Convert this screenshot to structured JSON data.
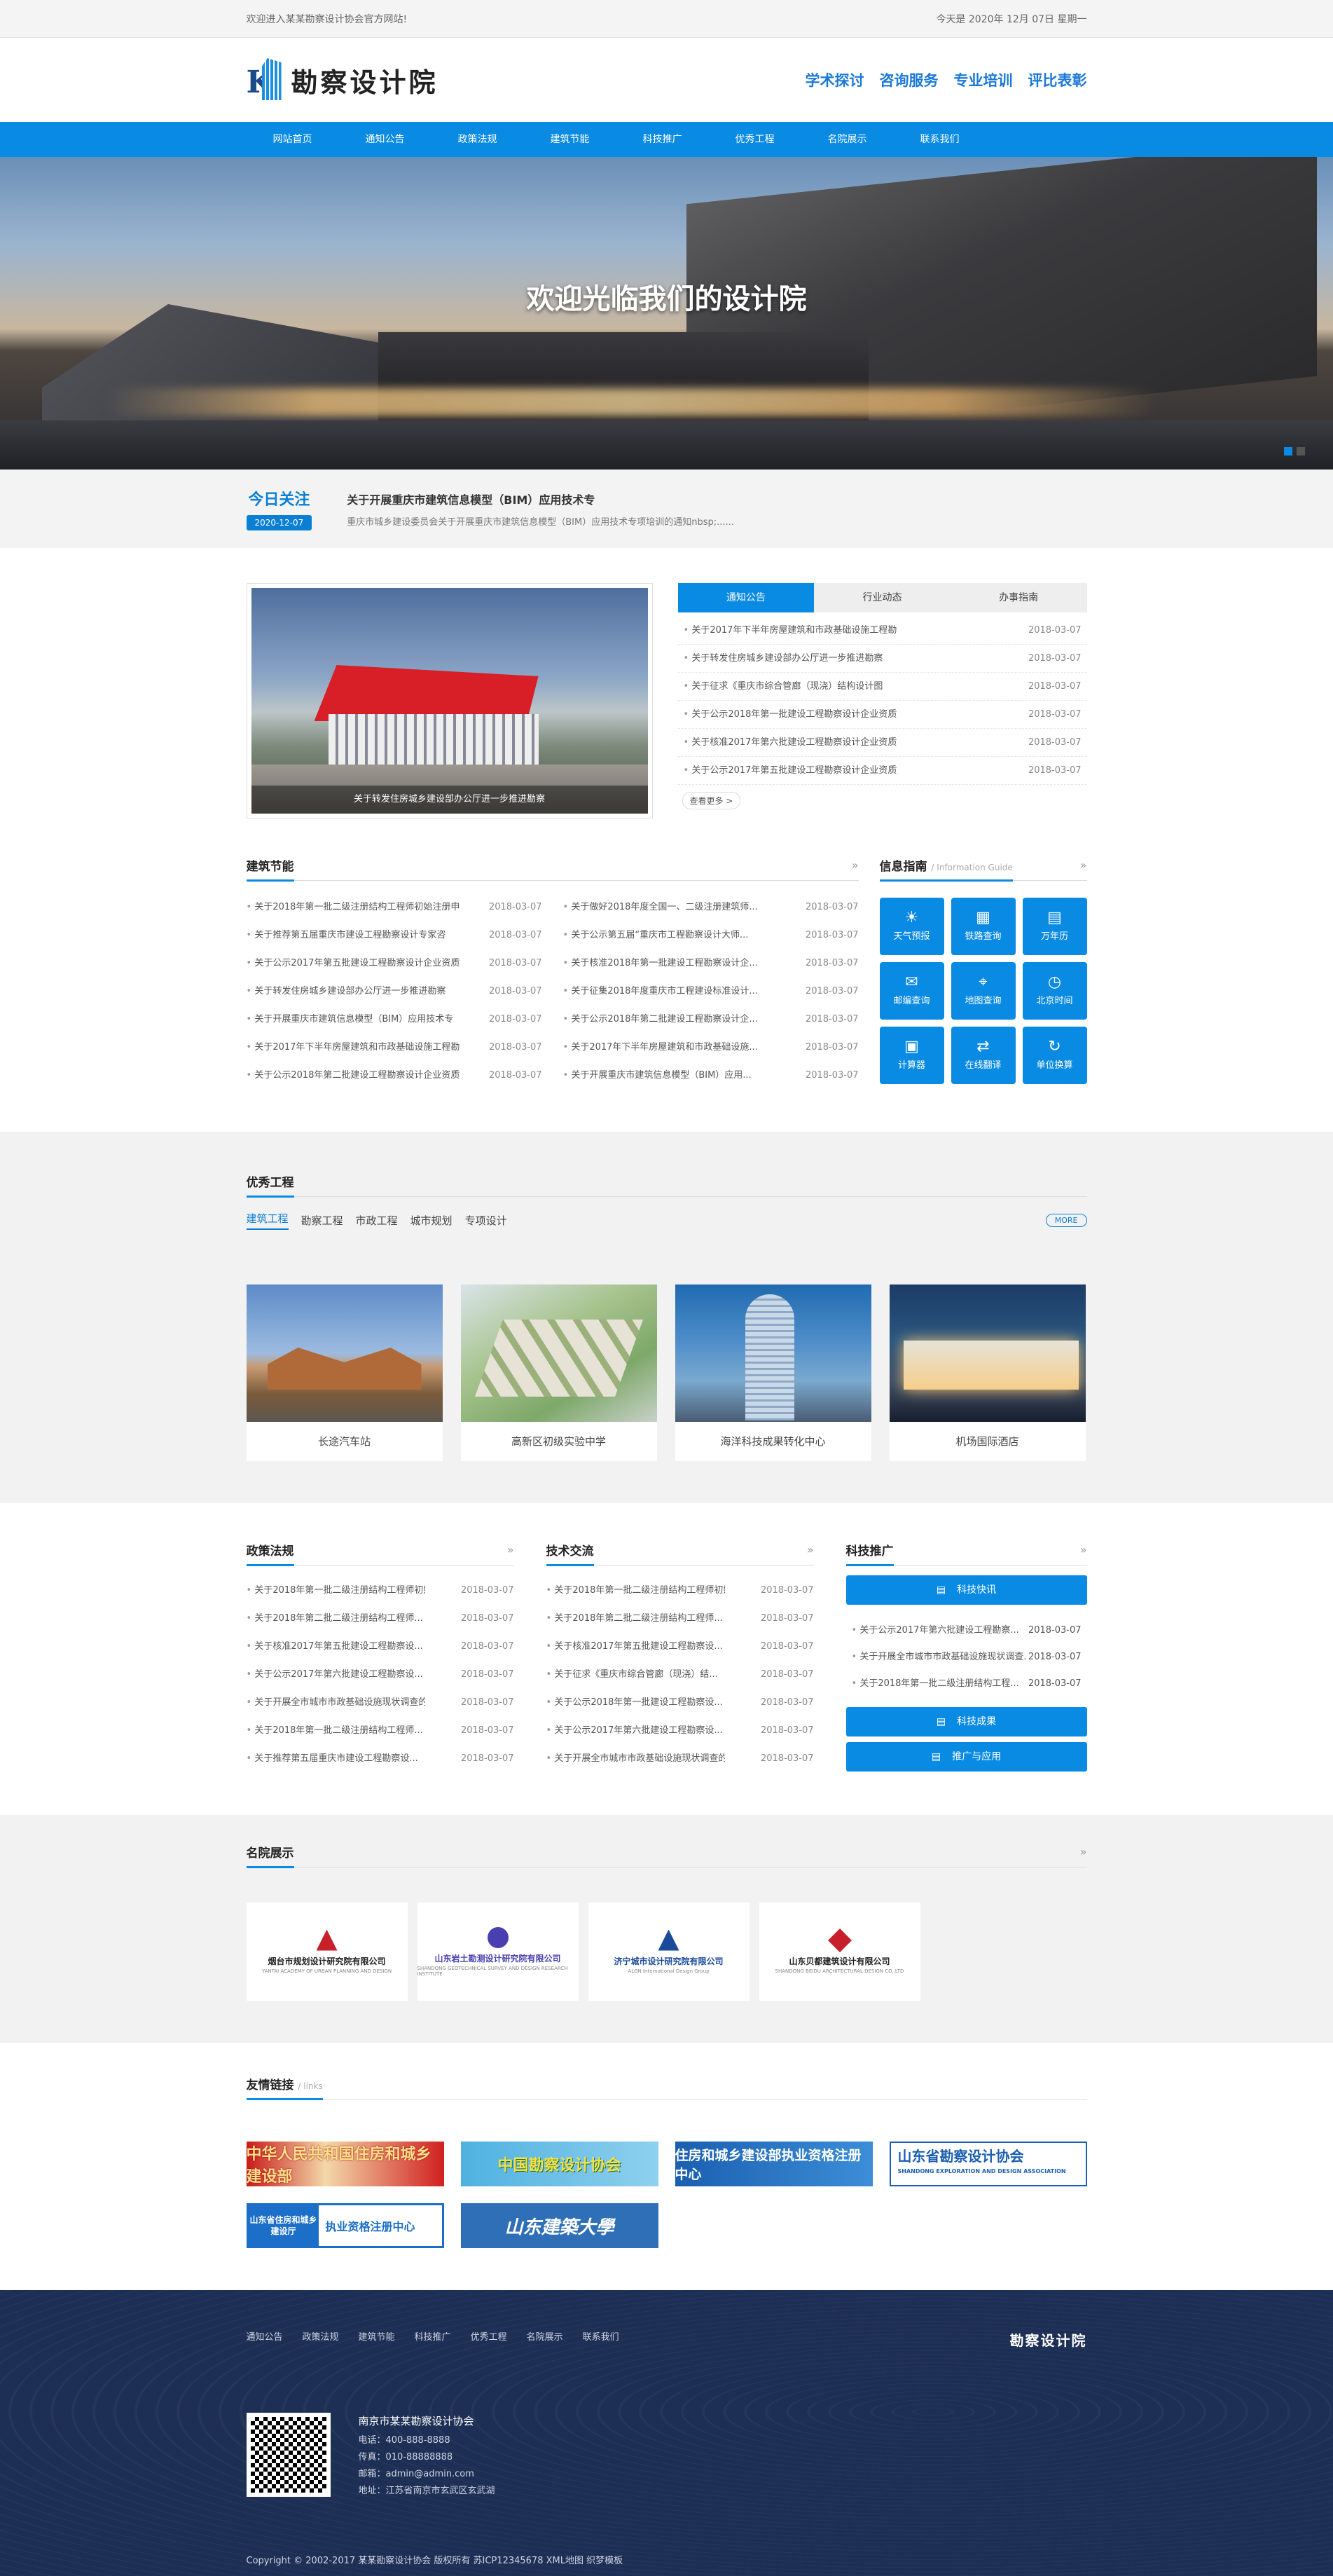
{
  "topbar": {
    "welcome": "欢迎进入某某勘察设计协会官方网站!",
    "date": "今天是 2020年 12月 07日 星期一"
  },
  "header": {
    "logo_text": "勘察设计院",
    "links": [
      "学术探讨",
      "咨询服务",
      "专业培训",
      "评比表彰"
    ]
  },
  "nav": [
    "网站首页",
    "通知公告",
    "政策法规",
    "建筑节能",
    "科技推广",
    "优秀工程",
    "名院展示",
    "联系我们"
  ],
  "banner": {
    "title": "欢迎光临我们的设计院"
  },
  "today": {
    "label": "今日关注",
    "date": "2020-12-07",
    "headline": "关于开展重庆市建筑信息模型（BIM）应用技术专",
    "summary": "重庆市城乡建设委员会关于开展重庆市建筑信息模型（BIM）应用技术专项培训的通知nbsp;......"
  },
  "feature": {
    "caption": "关于转发住房城乡建设部办公厅进一步推进勘察"
  },
  "notice": {
    "tabs": [
      "通知公告",
      "行业动态",
      "办事指南"
    ],
    "items": [
      {
        "t": "关于2017年下半年房屋建筑和市政基础设施工程勘",
        "d": "2018-03-07"
      },
      {
        "t": "关于转发住房城乡建设部办公厅进一步推进勘察",
        "d": "2018-03-07"
      },
      {
        "t": "关于征求《重庆市综合管廊（现浇）结构设计图",
        "d": "2018-03-07"
      },
      {
        "t": "关于公示2018年第一批建设工程勘察设计企业资质",
        "d": "2018-03-07"
      },
      {
        "t": "关于核准2017年第六批建设工程勘察设计企业资质",
        "d": "2018-03-07"
      },
      {
        "t": "关于公示2017年第五批建设工程勘察设计企业资质",
        "d": "2018-03-07"
      }
    ],
    "more": "查看更多 >"
  },
  "jianzhu": {
    "title": "建筑节能",
    "left": [
      {
        "t": "关于2018年第一批二级注册结构工程师初始注册申",
        "d": "2018-03-07"
      },
      {
        "t": "关于推荐第五届重庆市建设工程勘察设计专家咨",
        "d": "2018-03-07"
      },
      {
        "t": "关于公示2017年第五批建设工程勘察设计企业资质",
        "d": "2018-03-07"
      },
      {
        "t": "关于转发住房城乡建设部办公厅进一步推进勘察",
        "d": "2018-03-07"
      },
      {
        "t": "关于开展重庆市建筑信息模型（BIM）应用技术专",
        "d": "2018-03-07"
      },
      {
        "t": "关于2017年下半年房屋建筑和市政基础设施工程勘",
        "d": "2018-03-07"
      },
      {
        "t": "关于公示2018年第二批建设工程勘察设计企业资质",
        "d": "2018-03-07"
      }
    ],
    "right": [
      {
        "t": "关于做好2018年度全国一、二级注册建筑师...",
        "d": "2018-03-07"
      },
      {
        "t": "关于公示第五届“重庆市工程勘察设计大师...",
        "d": "2018-03-07"
      },
      {
        "t": "关于核准2018年第一批建设工程勘察设计企...",
        "d": "2018-03-07"
      },
      {
        "t": "关于征集2018年度重庆市工程建设标准设计...",
        "d": "2018-03-07"
      },
      {
        "t": "关于公示2018年第二批建设工程勘察设计企...",
        "d": "2018-03-07"
      },
      {
        "t": "关于2017年下半年房屋建筑和市政基础设施...",
        "d": "2018-03-07"
      },
      {
        "t": "关于开展重庆市建筑信息模型（BIM）应用...",
        "d": "2018-03-07"
      }
    ]
  },
  "info": {
    "title": "信息指南",
    "sub": "/ Information Guide",
    "buttons": [
      {
        "label": "天气预报",
        "icon": "☀"
      },
      {
        "label": "铁路查询",
        "icon": "▦"
      },
      {
        "label": "万年历",
        "icon": "▤"
      },
      {
        "label": "邮编查询",
        "icon": "✉"
      },
      {
        "label": "地图查询",
        "icon": "⌖"
      },
      {
        "label": "北京时间",
        "icon": "◷"
      },
      {
        "label": "计算器",
        "icon": "▣"
      },
      {
        "label": "在线翻译",
        "icon": "⇄"
      },
      {
        "label": "单位换算",
        "icon": "↻"
      }
    ]
  },
  "projects": {
    "title": "优秀工程",
    "tabs": [
      "建筑工程",
      "勘察工程",
      "市政工程",
      "城市规划",
      "专项设计"
    ],
    "more": "MORE",
    "items": [
      "长途汽车站",
      "高新区初级实验中学",
      "海洋科技成果转化中心",
      "机场国际酒店"
    ]
  },
  "policy": {
    "title": "政策法规",
    "items": [
      {
        "t": "关于2018年第一批二级注册结构工程师初始...",
        "d": "2018-03-07"
      },
      {
        "t": "关于2018年第二批二级注册结构工程师...",
        "d": "2018-03-07"
      },
      {
        "t": "关于核准2017年第五批建设工程勘察设...",
        "d": "2018-03-07"
      },
      {
        "t": "关于公示2017年第六批建设工程勘察设...",
        "d": "2018-03-07"
      },
      {
        "t": "关于开展全市城市市政基础设施现状调查的...",
        "d": "2018-03-07"
      },
      {
        "t": "关于2018年第一批二级注册结构工程师...",
        "d": "2018-03-07"
      },
      {
        "t": "关于推荐第五届重庆市建设工程勘察设...",
        "d": "2018-03-07"
      }
    ]
  },
  "tech": {
    "title": "技术交流",
    "items": [
      {
        "t": "关于2018年第一批二级注册结构工程师初始...",
        "d": "2018-03-07"
      },
      {
        "t": "关于2018年第二批二级注册结构工程师...",
        "d": "2018-03-07"
      },
      {
        "t": "关于核准2017年第五批建设工程勘察设...",
        "d": "2018-03-07"
      },
      {
        "t": "关于征求《重庆市综合管廊（现浇）结...",
        "d": "2018-03-07"
      },
      {
        "t": "关于公示2018年第一批建设工程勘察设...",
        "d": "2018-03-07"
      },
      {
        "t": "关于公示2017年第六批建设工程勘察设...",
        "d": "2018-03-07"
      },
      {
        "t": "关于开展全市城市市政基础设施现状调查的...",
        "d": "2018-03-07"
      }
    ]
  },
  "science": {
    "title": "科技推广",
    "btn1": "科技快讯",
    "btn2": "科技成果",
    "btn3": "推广与应用",
    "items": [
      {
        "t": "关于公示2017年第六批建设工程勘察...",
        "d": "2018-03-07"
      },
      {
        "t": "关于开展全市城市市政基础设施现状调查...",
        "d": "2018-03-07"
      },
      {
        "t": "关于2018年第一批二级注册结构工程...",
        "d": "2018-03-07"
      }
    ]
  },
  "famous": {
    "title": "名院展示",
    "items": [
      {
        "name": "烟台市规划设计研究院有限公司",
        "sub": "YANTAI ACADEMY OF URBAN PLANNING AND DESIGN",
        "color": "#c8202a"
      },
      {
        "name": "山东岩土勘测设计研究院有限公司",
        "sub": "SHANDONG GEOTECHNICAL SURVEY AND DESIGN RESEARCH INSTITUTE",
        "color": "#4a3fb0"
      },
      {
        "name": "济宁城市设计研究院有限公司",
        "sub": "ALGN International Design Group",
        "color": "#1a4a9a"
      },
      {
        "name": "山东贝都建筑设计有限公司",
        "sub": "SHANDONG BEIDU ARCHITECTURAL DESIGN CO.,LTD",
        "color": "#c8202a"
      }
    ]
  },
  "links": {
    "title": "友情链接",
    "sub": "/ links",
    "items": [
      "中华人民共和国住房和城乡建设部",
      "中国勘察设计协会",
      "住房和城乡建设部执业资格注册中心",
      "山东省勘察设计协会"
    ],
    "l4_sub": "SHANDONG EXPLORATION AND DESIGN ASSOCIATION",
    "l5_a": "山东省住房和城乡建设厅",
    "l5_b": "执业资格注册中心",
    "l6": "山东建築大學"
  },
  "footer": {
    "nav": [
      "通知公告",
      "政策法规",
      "建筑节能",
      "科技推广",
      "优秀工程",
      "名院展示",
      "联系我们"
    ],
    "brand": "勘察设计院",
    "org": "南京市某某勘察设计协会",
    "tel": "电话：400-888-8888",
    "fax": "传真：010-88888888",
    "email": "邮箱：admin@admin.com",
    "addr": "地址：江苏省南京市玄武区玄武湖",
    "copyright": "Copyright © 2002-2017 某某勘察设计协会 版权所有  苏ICP12345678  XML地图  织梦模板"
  }
}
